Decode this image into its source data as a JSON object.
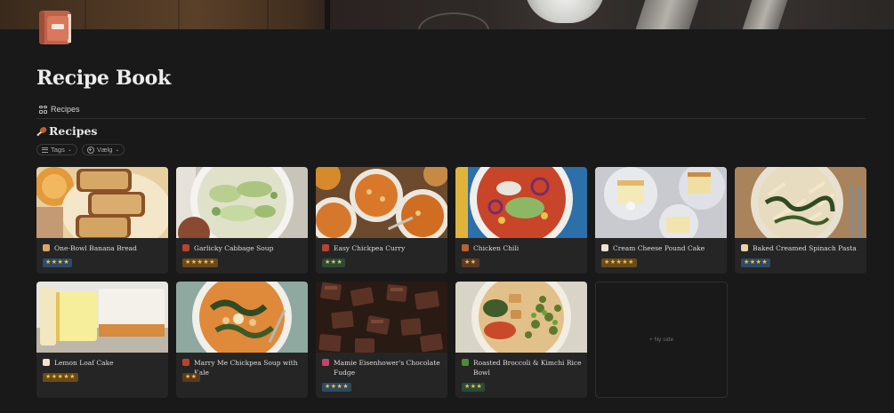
{
  "page": {
    "title": "Recipe Book",
    "view_tab": "Recipes",
    "database_title": "Recipes",
    "filters": {
      "tags": "Tags",
      "add": "Vælg"
    },
    "new_page_label": "+ Ny side"
  },
  "icons": {
    "page": "recipe-book-icon",
    "view": "gallery-grid-icon",
    "database": "drumstick-icon",
    "tags_filter": "list-icon",
    "add_filter": "plus-circle-icon"
  },
  "colors": {
    "background": "#191919",
    "card": "#252525",
    "star": "#f0c43c",
    "badge_blue": "#2d4a66",
    "badge_green": "#2b4a39",
    "badge_orange": "#6a4a1c",
    "badge_brown": "#5a3a26"
  },
  "recipes": [
    {
      "name": "One-Bowl Banana Bread",
      "icon": "bread-icon",
      "rating": "★★★★",
      "rating_count": 4
    },
    {
      "name": "Garlicky Cabbage Soup",
      "icon": "soup-pot-icon",
      "rating": "★★★★★",
      "rating_count": 5
    },
    {
      "name": "Easy Chickpea Curry",
      "icon": "soup-pot-icon",
      "rating": "★★★",
      "rating_count": 3
    },
    {
      "name": "Chicken Chili",
      "icon": "drumstick-icon",
      "rating": "★★",
      "rating_count": 2
    },
    {
      "name": "Cream Cheese Pound Cake",
      "icon": "cake-icon",
      "rating": "★★★★★",
      "rating_count": 5
    },
    {
      "name": "Baked Creamed Spinach Pasta",
      "icon": "pasta-icon",
      "rating": "★★★★",
      "rating_count": 4
    },
    {
      "name": "Lemon Loaf Cake",
      "icon": "cake-icon",
      "rating": "★★★★★",
      "rating_count": 5
    },
    {
      "name": "Marry Me Chickpea Soup with Kale",
      "icon": "soup-pot-icon",
      "rating": "★★",
      "rating_count": 2
    },
    {
      "name": "Mamie Eisenhower's Chocolate Fudge",
      "icon": "candy-icon",
      "rating": "★★★★",
      "rating_count": 4
    },
    {
      "name": "Roasted Broccoli & Kimchi Rice Bowl",
      "icon": "broccoli-icon",
      "rating": "★★★",
      "rating_count": 3
    }
  ]
}
